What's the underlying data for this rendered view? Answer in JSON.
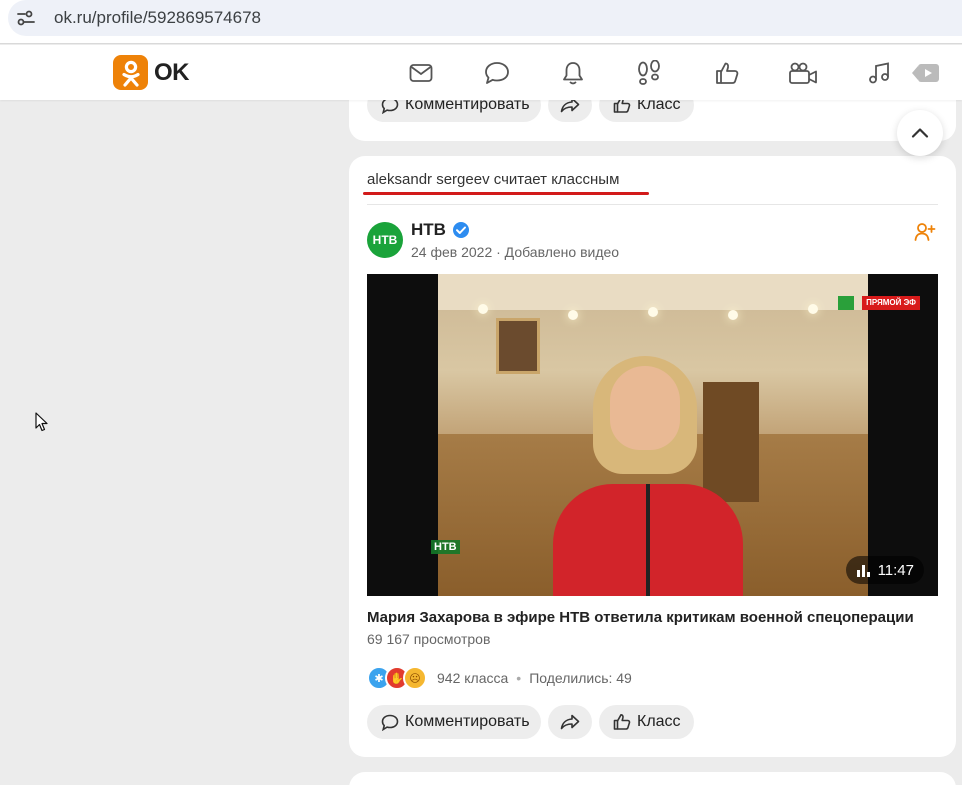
{
  "browser": {
    "url": "ok.ru/profile/592869574678"
  },
  "header": {
    "logo_text": "OK",
    "accent": "#ee8208",
    "nav_icons": [
      "messages-icon",
      "discussions-icon",
      "notifications-icon",
      "guests-icon",
      "marks-icon",
      "video-icon",
      "music-icon",
      "games-icon"
    ]
  },
  "top_card": {
    "comment_label": "Комментировать",
    "like_label": "Класс"
  },
  "post": {
    "liked_by_text": "aleksandr sergeev считает классным",
    "channel_name": "НТВ",
    "channel_avatar_text": "НТВ",
    "meta": "24 фев 2022 · Добавлено видео",
    "video": {
      "live_badge": "ПРЯМОЙ ЭФ",
      "watermark": "НТВ",
      "duration": "11:47"
    },
    "title": "Мария Захарова в эфире НТВ ответила критикам военной спецоперации",
    "views": "69 167 просмотров",
    "reactions_count": "942 класса",
    "shares": "Поделились: 49",
    "comment_label": "Комментировать",
    "like_label": "Класс"
  },
  "colors": {
    "underline": "#d21a1a",
    "ntv_green": "#1aa33a",
    "verified_blue": "#2d8cf0"
  }
}
